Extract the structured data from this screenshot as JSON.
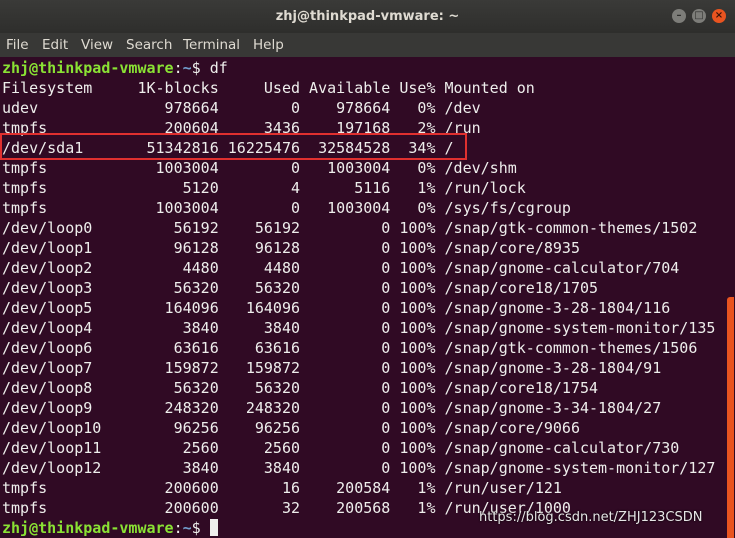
{
  "window": {
    "title": "zhj@thinkpad-vmware: ~"
  },
  "controls": {
    "minimize": "–",
    "maximize": "□",
    "close": "×"
  },
  "menu": [
    "File",
    "Edit",
    "View",
    "Search",
    "Terminal",
    "Help"
  ],
  "prompt": {
    "user_host": "zhj@thinkpad-vmware",
    "separator": ":",
    "path": "~",
    "symbol": "$ "
  },
  "command": "df",
  "lines": [
    "Filesystem     1K-blocks     Used Available Use% Mounted on",
    "udev              978664        0    978664   0% /dev",
    "tmpfs             200604     3436    197168   2% /run",
    "/dev/sda1       51342816 16225476  32584528  34% /",
    "tmpfs            1003004        0   1003004   0% /dev/shm",
    "tmpfs               5120        4      5116   1% /run/lock",
    "tmpfs            1003004        0   1003004   0% /sys/fs/cgroup",
    "/dev/loop0         56192    56192         0 100% /snap/gtk-common-themes/1502",
    "/dev/loop1         96128    96128         0 100% /snap/core/8935",
    "/dev/loop2          4480     4480         0 100% /snap/gnome-calculator/704",
    "/dev/loop3         56320    56320         0 100% /snap/core18/1705",
    "/dev/loop5        164096   164096         0 100% /snap/gnome-3-28-1804/116",
    "/dev/loop4          3840     3840         0 100% /snap/gnome-system-monitor/135",
    "/dev/loop6         63616    63616         0 100% /snap/gtk-common-themes/1506",
    "/dev/loop7        159872   159872         0 100% /snap/gnome-3-28-1804/91",
    "/dev/loop8         56320    56320         0 100% /snap/core18/1754",
    "/dev/loop9        248320   248320         0 100% /snap/gnome-3-34-1804/27",
    "/dev/loop10        96256    96256         0 100% /snap/core/9066",
    "/dev/loop11         2560     2560         0 100% /snap/gnome-calculator/730",
    "/dev/loop12         3840     3840         0 100% /snap/gnome-system-monitor/127",
    "tmpfs             200600       16    200584   1% /run/user/121",
    "tmpfs             200600       32    200568   1% /run/user/1000"
  ],
  "watermark": "https://blog.csdn.net/ZHJ123CSDN",
  "colors": {
    "background": "#300a24",
    "prompt_user": "#8ae234",
    "prompt_path": "#729fcf",
    "highlight_box": "#e0302f",
    "scrollbar": "#e95420"
  }
}
